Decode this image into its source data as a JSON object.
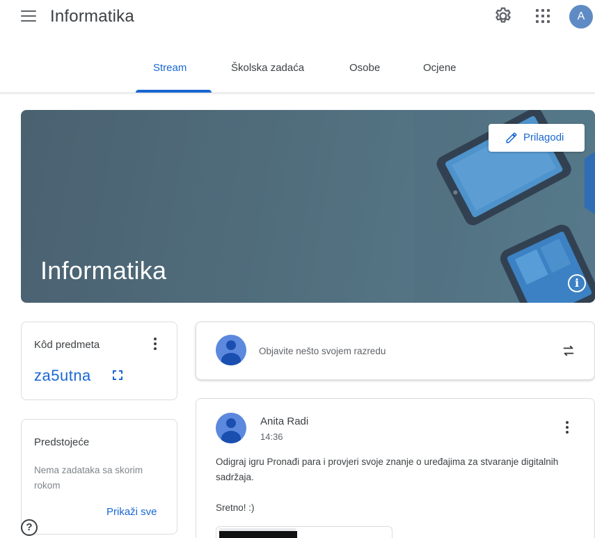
{
  "app": {
    "title": "Informatika",
    "avatar_letter": "A"
  },
  "tabs": [
    {
      "label": "Stream",
      "active": true
    },
    {
      "label": "Školska zadaća",
      "active": false
    },
    {
      "label": "Osobe",
      "active": false
    },
    {
      "label": "Ocjene",
      "active": false
    }
  ],
  "banner": {
    "title": "Informatika",
    "customize_label": "Prilagodi"
  },
  "class_code": {
    "label": "Kôd predmeta",
    "value": "za5utna"
  },
  "upcoming": {
    "title": "Predstojeće",
    "empty_text": "Nema zadataka sa skorim rokom",
    "view_all": "Prikaži sve"
  },
  "compose": {
    "placeholder": "Objavite nešto svojem razredu"
  },
  "post": {
    "author": "Anita Radi",
    "time": "14:36",
    "paragraphs": [
      "Odigraj igru Pronađi para i provjeri svoje znanje o uređajima za stvaranje digitalnih sadržaja.",
      "Sretno! :)"
    ]
  },
  "colors": {
    "accent": "#1967d2",
    "banner": "#52707f",
    "avatar": "#5f8bc4"
  },
  "icons": [
    "menu-icon",
    "gear-icon",
    "apps-grid-icon",
    "pencil-icon",
    "info-icon",
    "more-vert-icon",
    "fullscreen-icon",
    "repost-icon",
    "help-icon"
  ]
}
